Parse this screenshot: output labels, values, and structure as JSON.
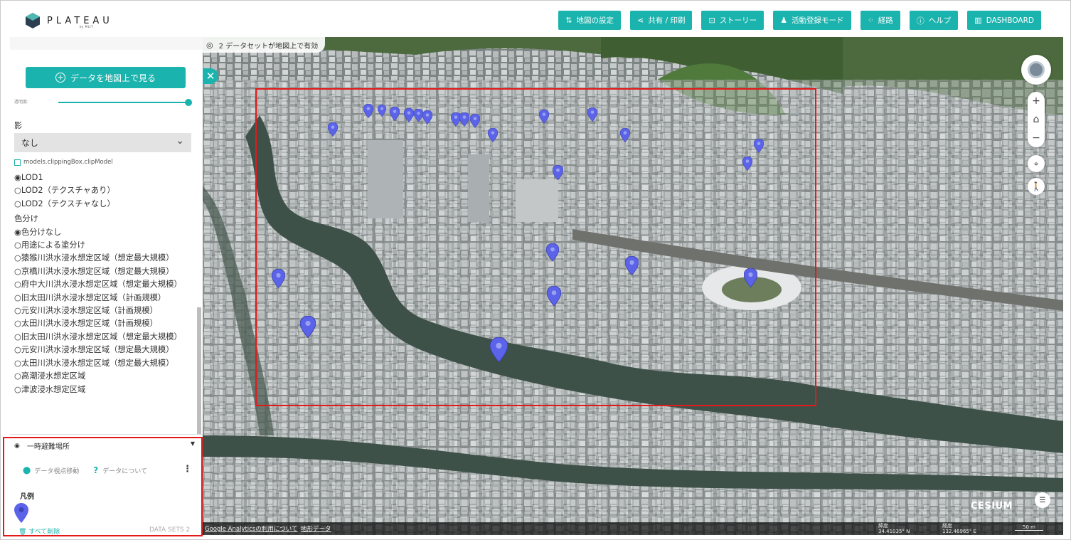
{
  "app": {
    "logo_text": "PLATEAU",
    "logo_sub": "by MLIT"
  },
  "toolbar": {
    "buttons": [
      {
        "label": "地図の設定",
        "icon": "sliders-icon"
      },
      {
        "label": "共有 / 印刷",
        "icon": "share-icon"
      },
      {
        "label": "ストーリー",
        "icon": "story-icon"
      },
      {
        "label": "活動登録モード",
        "icon": "people-icon"
      },
      {
        "label": "経路",
        "icon": "route-icon"
      },
      {
        "label": "ヘルプ",
        "icon": "help-icon"
      },
      {
        "label": "DASHBOARD",
        "icon": "book-icon"
      }
    ]
  },
  "sidebar": {
    "view_button": "データを地図上で見る",
    "slider_label": "透明度:",
    "slider_value": 1.0,
    "shadow_label": "影",
    "shadow_value": "なし",
    "clip_model_label": "models.clippingBox.clipModel",
    "lod_options": [
      {
        "label": "LOD1",
        "selected": true
      },
      {
        "label": "LOD2（テクスチャあり）",
        "selected": false
      },
      {
        "label": "LOD2（テクスチャなし）",
        "selected": false
      }
    ],
    "coloring_label": "色分け",
    "coloring_options": [
      {
        "label": "色分けなし",
        "selected": true
      },
      {
        "label": "用途による塗分け",
        "selected": false
      },
      {
        "label": "猿猴川洪水浸水想定区域（想定最大規模）",
        "selected": false
      },
      {
        "label": "京橋川洪水浸水想定区域（想定最大規模）",
        "selected": false
      },
      {
        "label": "府中大川洪水浸水想定区域（想定最大規模）",
        "selected": false
      },
      {
        "label": "旧太田川洪水浸水想定区域（計画規模）",
        "selected": false
      },
      {
        "label": "元安川洪水浸水想定区域（計画規模）",
        "selected": false
      },
      {
        "label": "太田川洪水浸水想定区域（計画規模）",
        "selected": false
      },
      {
        "label": "旧太田川洪水浸水想定区域（想定最大規模）",
        "selected": false
      },
      {
        "label": "元安川洪水浸水想定区域（想定最大規模）",
        "selected": false
      },
      {
        "label": "太田川洪水浸水想定区域（想定最大規模）",
        "selected": false
      },
      {
        "label": "高潮浸水想定区域",
        "selected": false
      },
      {
        "label": "津波浸水想定区域",
        "selected": false
      }
    ],
    "dataset_panel": {
      "title": "一時避難場所",
      "action_move": "データ視点移動",
      "action_about": "データについて",
      "legend_title": "凡例",
      "legend_pin_color": "#5b63e8"
    },
    "remove_all": "すべて削除",
    "dataset_count": "DATA SETS 2"
  },
  "map": {
    "active_datasets": "2 データセットが地図上で有効",
    "footer_ga": "Google Analyticsの利用について",
    "footer_terrain": "地形データ",
    "lat_label": "緯度",
    "lat_value": "34.41035° N",
    "lon_label": "経度",
    "lon_value": "132.46965° E",
    "scale": "50 m",
    "attribution": "CESIUM",
    "pin_color": "#5b63e8"
  },
  "colors": {
    "accent": "#1bb3ad",
    "highlight": "#e41a1a"
  }
}
